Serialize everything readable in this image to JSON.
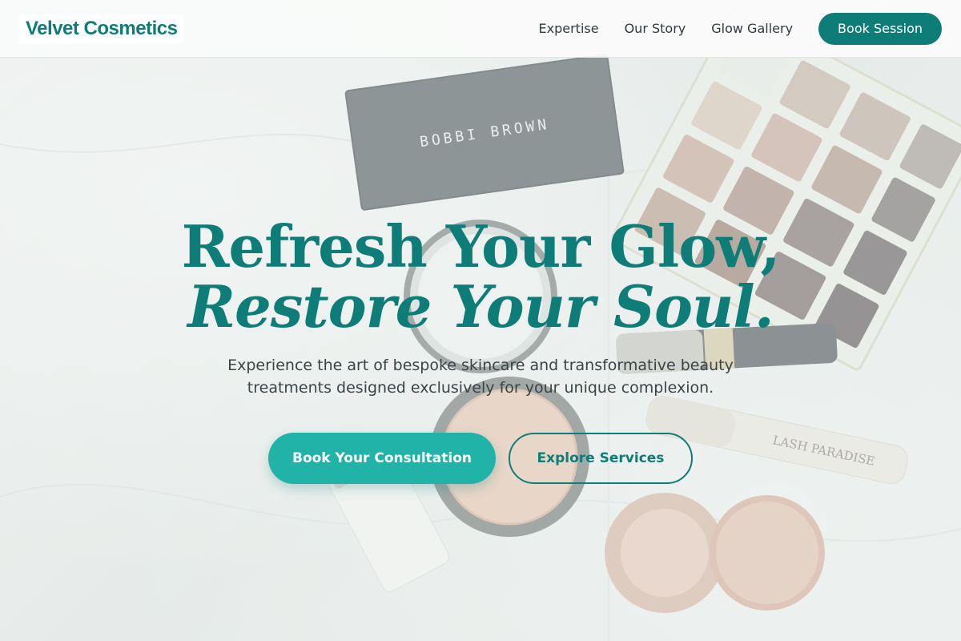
{
  "brand": {
    "logo_text": "Velvet Cosmetics"
  },
  "nav": {
    "links": [
      "Expertise",
      "Our Story",
      "Glow Gallery"
    ],
    "cta": "Book Session"
  },
  "hero": {
    "headline_line1": "Refresh Your Glow,",
    "headline_line2": "Restore Your Soul.",
    "subtitle": "Experience the art of bespoke skincare and transformative beauty treatments designed exclusively for your unique complexion.",
    "primary_cta": "Book Your Consultation",
    "secondary_cta": "Explore Services",
    "photo_text": {
      "palette_brand": "BOBBI BROWN",
      "mascara_brand": "LASH PARADISE"
    }
  },
  "colors": {
    "brand_teal": "#0e7d78",
    "accent_teal": "#21b2a8",
    "text_dark": "#2f3b3d"
  }
}
